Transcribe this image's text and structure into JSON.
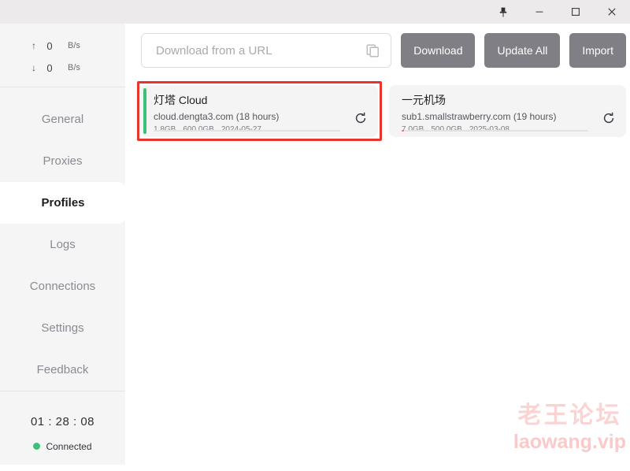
{
  "titlebar": {
    "buttons": [
      {
        "name": "pin",
        "label": "Pin"
      },
      {
        "name": "minimize",
        "label": "Minimize"
      },
      {
        "name": "maximize",
        "label": "Maximize"
      },
      {
        "name": "close",
        "label": "Close"
      }
    ]
  },
  "sidebar": {
    "speed": {
      "upload": {
        "arrow": "↑",
        "value": "0",
        "unit": "B/s"
      },
      "download": {
        "arrow": "↓",
        "value": "0",
        "unit": "B/s"
      }
    },
    "items": [
      {
        "label": "General",
        "active": false
      },
      {
        "label": "Proxies",
        "active": false
      },
      {
        "label": "Profiles",
        "active": true
      },
      {
        "label": "Logs",
        "active": false
      },
      {
        "label": "Connections",
        "active": false
      },
      {
        "label": "Settings",
        "active": false
      },
      {
        "label": "Feedback",
        "active": false
      }
    ],
    "status": {
      "timer": "01 : 28 : 08",
      "connection": "Connected",
      "connection_color": "#3ec07a"
    }
  },
  "toolbar": {
    "url_placeholder": "Download from a URL",
    "url_value": "",
    "paste_icon": "copy-icon",
    "download_label": "Download",
    "update_all_label": "Update All",
    "import_label": "Import"
  },
  "profiles": [
    {
      "title": "灯塔 Cloud",
      "subtitle": "cloud.dengta3.com (18 hours)",
      "used": "1.8GB",
      "total": "600.0GB",
      "date": "2024-05-27",
      "accent_color": "#3ec07a",
      "progress_percent": 0,
      "progress_color": "#e8352b",
      "selected": true
    },
    {
      "title": "一元机场",
      "subtitle": "sub1.smallstrawberry.com (19 hours)",
      "used": "7.0GB",
      "total": "500.0GB",
      "date": "2025-03-08",
      "accent_color": "transparent",
      "progress_percent": 1.4,
      "progress_color": "#e8707a",
      "selected": false
    }
  ],
  "watermark": {
    "line1": "老王论坛",
    "line2": "laowang.vip"
  }
}
